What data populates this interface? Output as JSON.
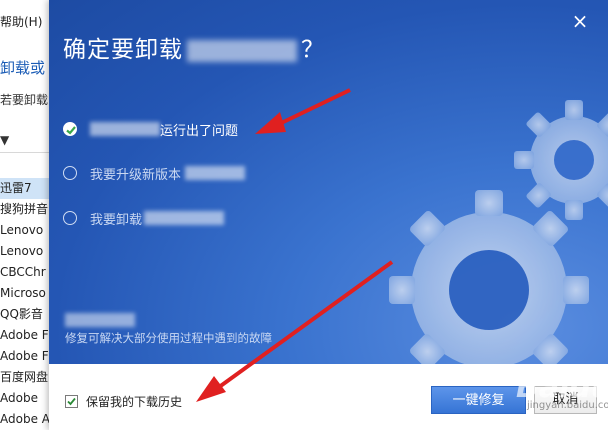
{
  "background": {
    "menu": "帮助(H)",
    "link": "卸载或",
    "desc": "若要卸载",
    "sort": "▼",
    "programs": [
      "迅雷7",
      "搜狗拼音",
      "Lenovo",
      "Lenovo",
      "CBCChr",
      "Microso",
      "QQ影音",
      "Adobe F",
      "Adobe F",
      "百度网盘",
      "Adobe",
      "Adobe A"
    ],
    "selected_index": 0
  },
  "dialog": {
    "title_prefix": "确定要卸载",
    "title_suffix": "？",
    "close_glyph": "×",
    "options": [
      {
        "text": "运行出了问题",
        "checked": true
      },
      {
        "text": "我要升级新版本",
        "checked": false
      },
      {
        "text": "我要卸载",
        "checked": false
      }
    ],
    "description": "修复可解决大部分使用过程中遇到的故障",
    "keep_history_label": "保留我的下载历史",
    "keep_history_checked": true,
    "primary_button": "一键修复",
    "cancel_button": "取消"
  },
  "watermark": {
    "main": "Baidu 经验",
    "sub": "jingyan.baidu.com"
  },
  "colors": {
    "dialog_blue": "#2456b4",
    "arrow_red": "#e02020",
    "button_blue": "#3674d5"
  }
}
